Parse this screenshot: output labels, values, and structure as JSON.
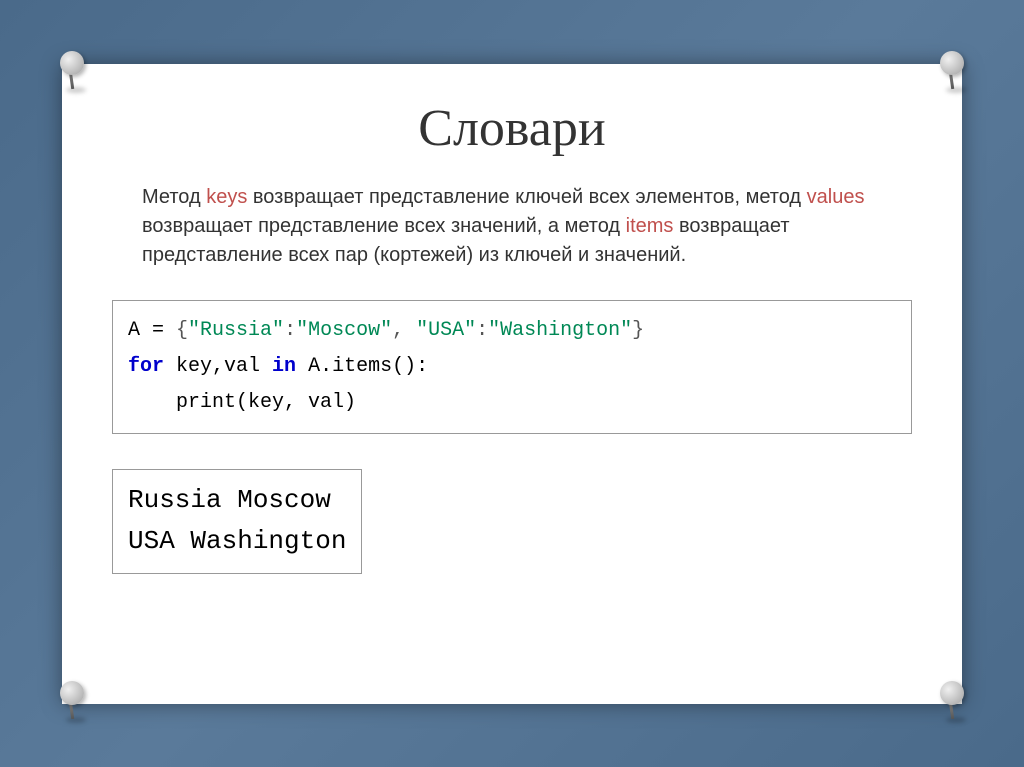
{
  "title": "Словари",
  "paragraph": {
    "p1": "Метод ",
    "keys": "keys",
    "p2": " возвращает представление ключей всех элементов, метод ",
    "values": "values",
    "p3": " возвращает представление всех значений, а метод ",
    "items": "items",
    "p4": " возвращает представление всех пар (кортежей) из ключей и значений."
  },
  "code": {
    "line1": {
      "var": "A",
      "eq": " = ",
      "brace_open": "{",
      "str1": "\"Russia\"",
      "colon1": ":",
      "str2": "\"Moscow\"",
      "comma": ", ",
      "str3": "\"USA\"",
      "colon2": ":",
      "str4": "\"Washington\"",
      "brace_close": "}"
    },
    "line2": {
      "for_kw": "for",
      "vars": " key,val ",
      "in_kw": "in",
      "call": " A.items():",
      "indent": "    ",
      "print": "print",
      "args": "(key, val)"
    }
  },
  "output": {
    "line1": "Russia Moscow",
    "line2": "USA Washington"
  }
}
